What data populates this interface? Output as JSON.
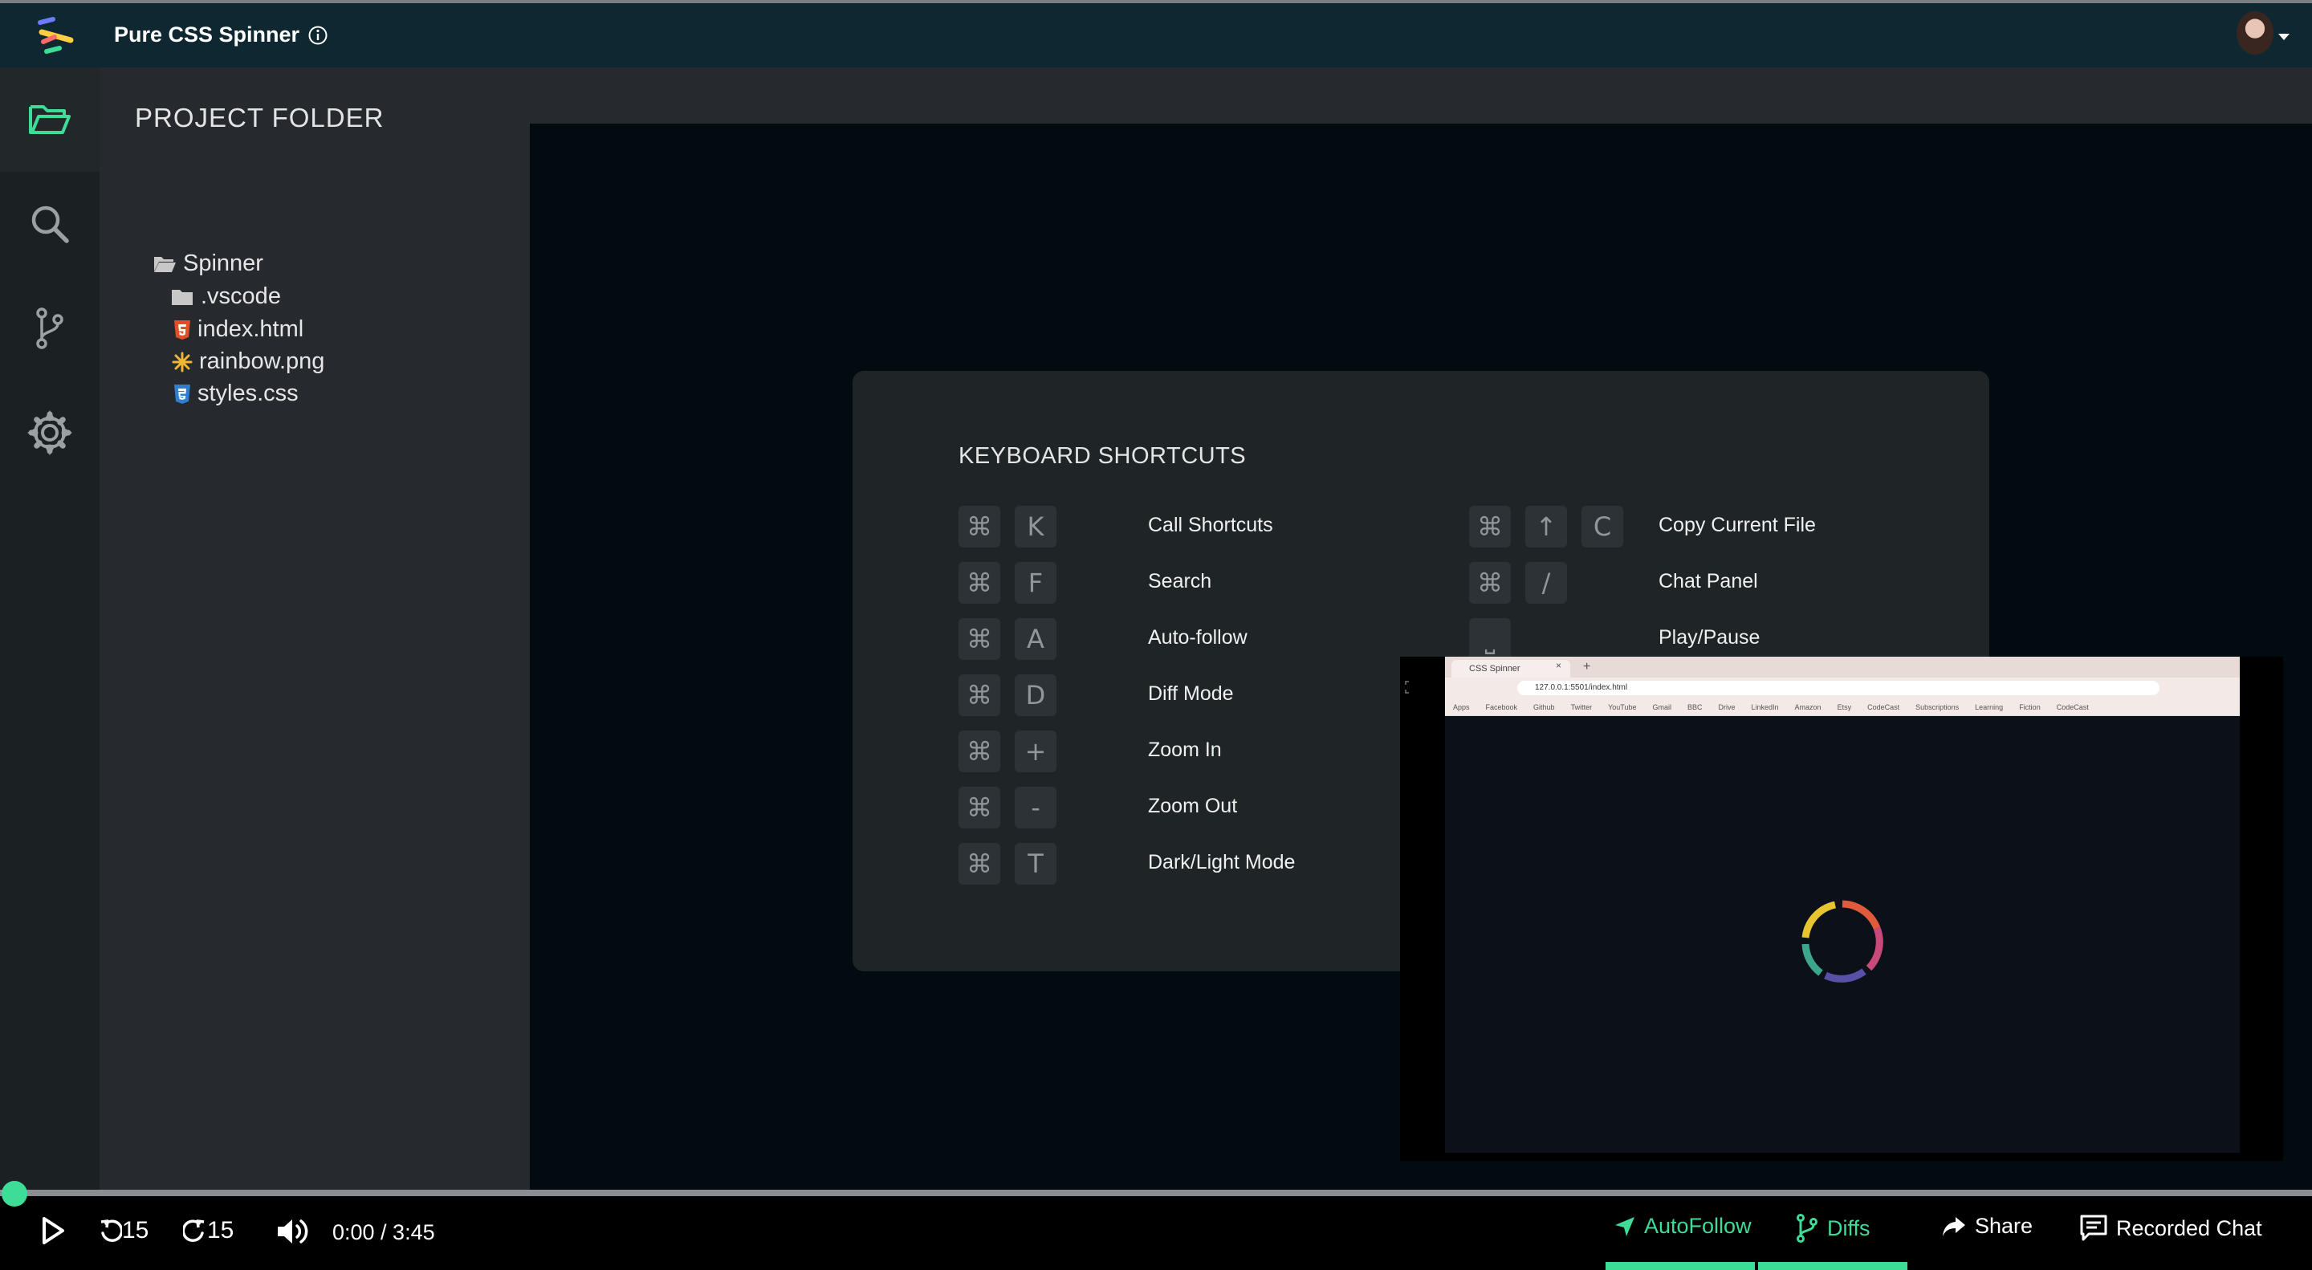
{
  "header": {
    "title": "Pure CSS Spinner"
  },
  "sidebar": {
    "icons": [
      "folder-open-icon",
      "search-icon",
      "branch-icon",
      "gear-icon"
    ]
  },
  "explorer": {
    "title": "PROJECT FOLDER",
    "items": [
      {
        "label": "Spinner",
        "icon": "folder-open-icon"
      },
      {
        "label": ".vscode",
        "icon": "folder-icon"
      },
      {
        "label": "index.html",
        "icon": "html5-icon"
      },
      {
        "label": "rainbow.png",
        "icon": "image-icon"
      },
      {
        "label": "styles.css",
        "icon": "css3-icon"
      }
    ]
  },
  "shortcuts": {
    "title": "KEYBOARD SHORTCUTS",
    "left": [
      {
        "keys": [
          "⌘",
          "K"
        ],
        "label": "Call Shortcuts"
      },
      {
        "keys": [
          "⌘",
          "F"
        ],
        "label": "Search"
      },
      {
        "keys": [
          "⌘",
          "A"
        ],
        "label": "Auto-follow"
      },
      {
        "keys": [
          "⌘",
          "D"
        ],
        "label": "Diff Mode"
      },
      {
        "keys": [
          "⌘",
          "+"
        ],
        "label": "Zoom In"
      },
      {
        "keys": [
          "⌘",
          "-"
        ],
        "label": "Zoom Out"
      },
      {
        "keys": [
          "⌘",
          "T"
        ],
        "label": "Dark/Light Mode"
      }
    ],
    "right": [
      {
        "keys": [
          "⌘",
          "↑",
          "C"
        ],
        "label": "Copy Current File"
      },
      {
        "keys": [
          "⌘",
          "/"
        ],
        "label": "Chat Panel"
      },
      {
        "keys": [
          "⎵"
        ],
        "label": "Play/Pause"
      }
    ]
  },
  "video": {
    "browser_tab": "CSS Spinner",
    "url": "127.0.0.1:5501/index.html",
    "bookmarks": [
      "Apps",
      "Facebook",
      "Github",
      "Twitter",
      "YouTube",
      "Gmail",
      "BBC",
      "Drive",
      "LinkedIn",
      "Amazon",
      "Etsy",
      "CodeCast",
      "Subscriptions",
      "Learning",
      "Fiction",
      "CodeCast"
    ]
  },
  "player": {
    "back_label": "15",
    "forward_label": "15",
    "time": "0:00 / 3:45",
    "progress": 0.0,
    "autofollow_label": "AutoFollow",
    "diffs_label": "Diffs",
    "share_label": "Share",
    "chat_label": "Recorded Chat"
  },
  "colors": {
    "accent": "#3ddc97",
    "header_bg": "#0f2730",
    "sidebar_bg": "#1b2023",
    "explorer_bg": "#262a2e",
    "panel_bg": "#1f2427"
  }
}
